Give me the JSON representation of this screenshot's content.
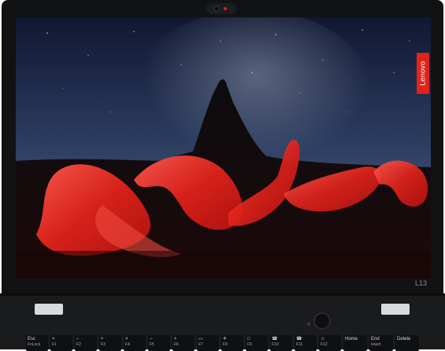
{
  "brand": {
    "logo_text": "Lenovo",
    "logo_color": "#e2231a",
    "model": "L13"
  },
  "colors": {
    "bezel": "#111214",
    "deck": "#1a1b1d",
    "light_trail": "#e2231a",
    "sky_top": "#141a31",
    "sky_bottom": "#3b4c6f"
  },
  "keyboard": {
    "keys": [
      {
        "main": "Esc",
        "sub": "FnLock"
      },
      {
        "main": "×",
        "sub": "F1"
      },
      {
        "main": "−",
        "sub": "F2"
      },
      {
        "main": "+",
        "sub": "F3"
      },
      {
        "main": "×",
        "sub": "F4"
      },
      {
        "main": "−",
        "sub": "F5"
      },
      {
        "main": "+",
        "sub": "F6"
      },
      {
        "main": "▭",
        "sub": "F7"
      },
      {
        "main": "✈",
        "sub": "F8"
      },
      {
        "main": "□",
        "sub": "F9"
      },
      {
        "main": "☎",
        "sub": "F10"
      },
      {
        "main": "☎",
        "sub": "F11"
      },
      {
        "main": "☆",
        "sub": "F12"
      },
      {
        "main": "Home",
        "sub": ""
      },
      {
        "main": "End",
        "sub": "Insert"
      },
      {
        "main": "Delete",
        "sub": ""
      }
    ]
  }
}
